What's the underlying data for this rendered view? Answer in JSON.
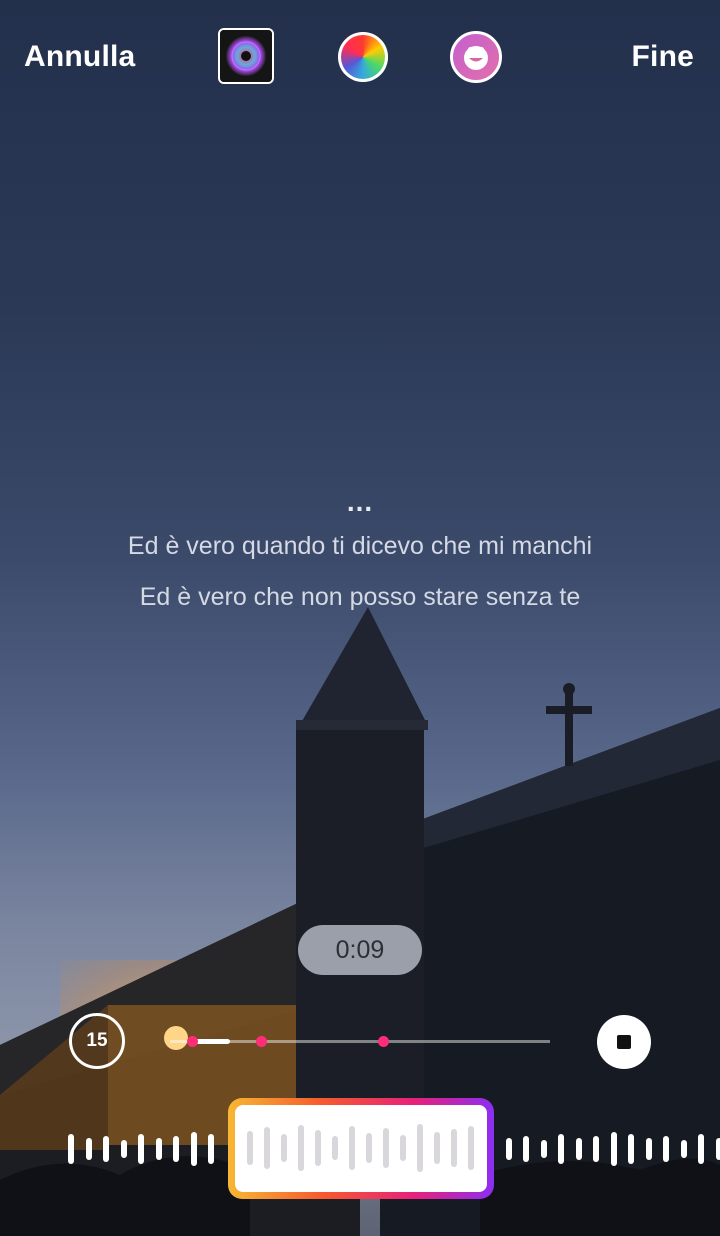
{
  "topbar": {
    "cancel_label": "Annulla",
    "done_label": "Fine",
    "album_icon": "album-cover-icon",
    "color_icon": "color-wheel-icon",
    "style_icon": "sticker-face-icon"
  },
  "lyrics": {
    "ellipsis": "...",
    "line1": "Ed è vero quando ti dicevo che mi manchi",
    "line2": "Ed è vero che non posso stare senza te"
  },
  "playback": {
    "elapsed": "0:09",
    "skip_label": "15",
    "progress": 0.1,
    "markers": [
      0.24,
      0.56
    ]
  },
  "colors": {
    "accent": "#ff2d78",
    "selector_gradient": [
      "#f7b733",
      "#f65b2d",
      "#e8207a",
      "#8c2ef2"
    ]
  }
}
